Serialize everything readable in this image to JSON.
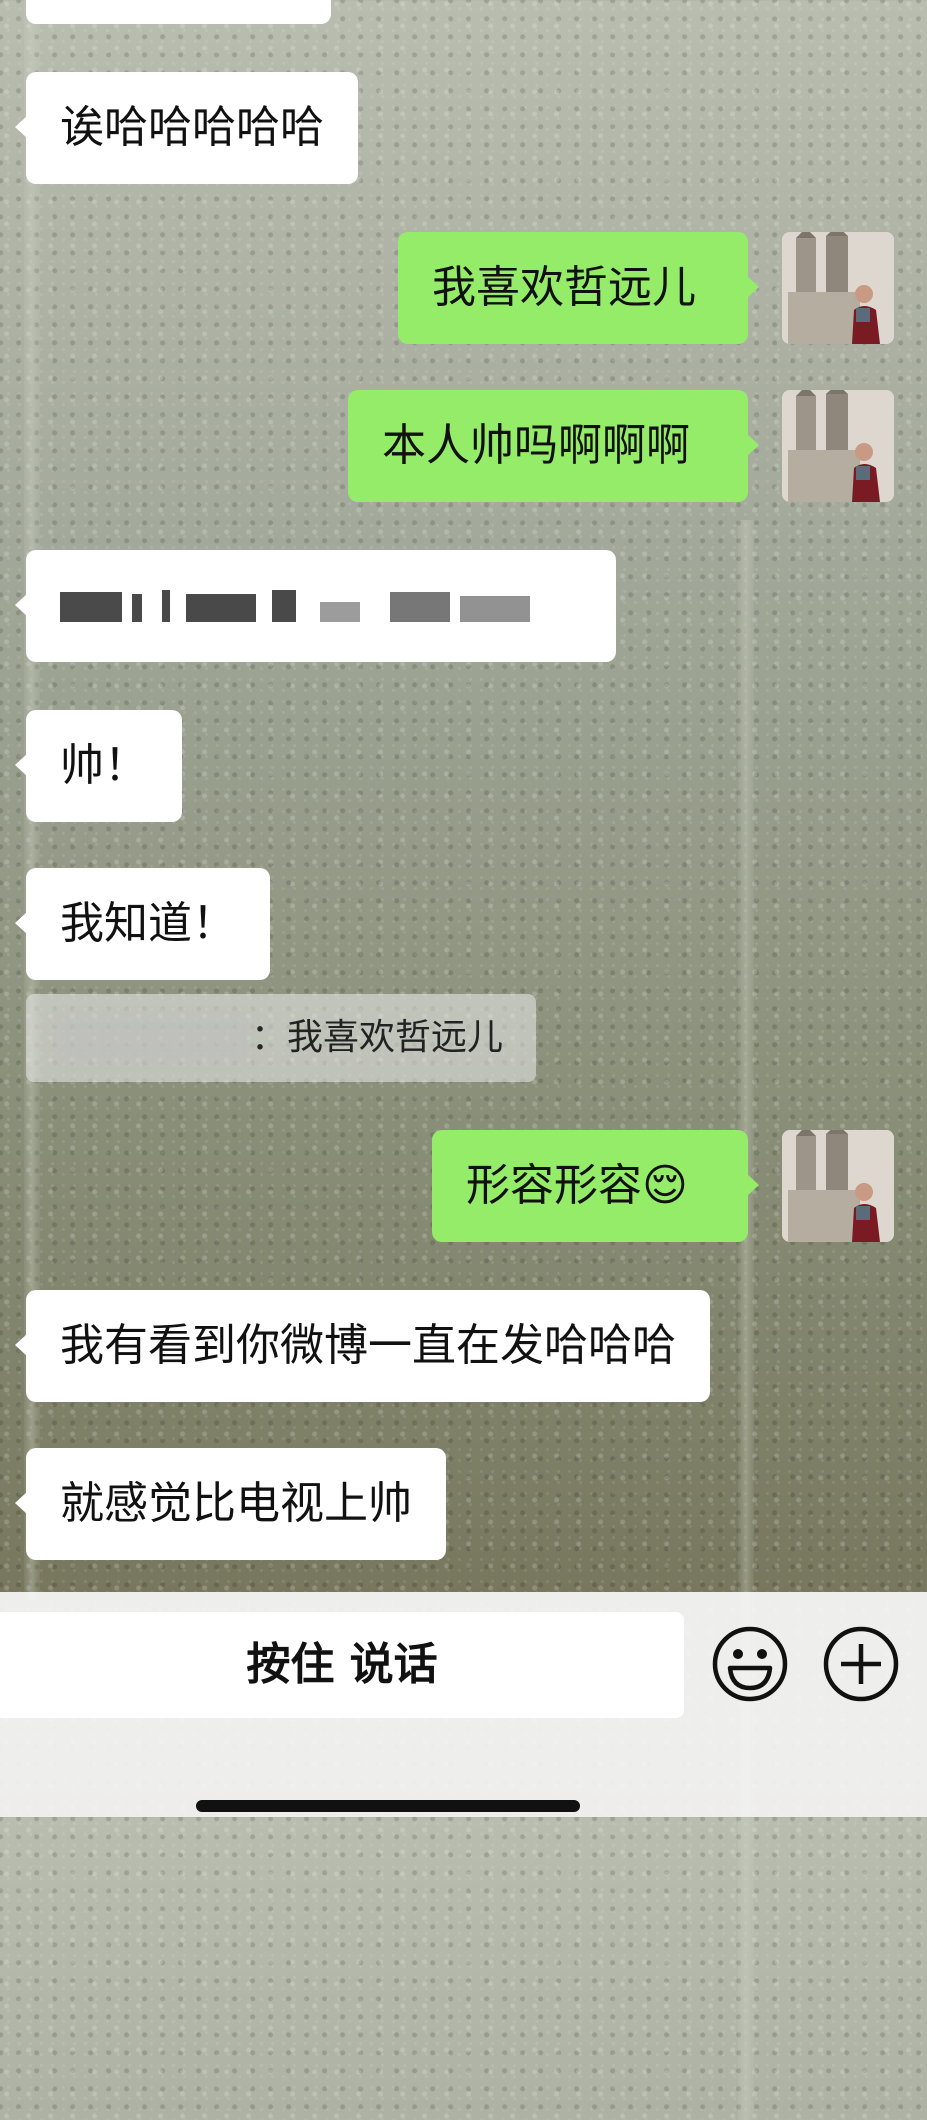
{
  "conversation": {
    "messages": [
      {
        "direction": "in",
        "text": "诶哈哈哈哈哈"
      },
      {
        "direction": "out",
        "text": "我喜欢哲远儿"
      },
      {
        "direction": "out",
        "text": "本人帅吗啊啊啊"
      },
      {
        "direction": "in",
        "text": "",
        "redacted": true
      },
      {
        "direction": "in",
        "text": "帅！"
      },
      {
        "direction": "in",
        "text": "我知道！"
      },
      {
        "direction": "out",
        "text": "形容形容😌"
      },
      {
        "direction": "in",
        "text": "我有看到你微博一直在发哈哈哈"
      },
      {
        "direction": "in",
        "text": "就感觉比电视上帅"
      }
    ],
    "quote": {
      "separator": "：",
      "text": "我喜欢哲远儿"
    }
  },
  "input_bar": {
    "voice_label": "按住 说话",
    "emoji_icon": "emoji-icon",
    "plus_icon": "plus-icon"
  },
  "colors": {
    "outgoing_bubble": "#95ec69",
    "incoming_bubble": "#ffffff"
  }
}
